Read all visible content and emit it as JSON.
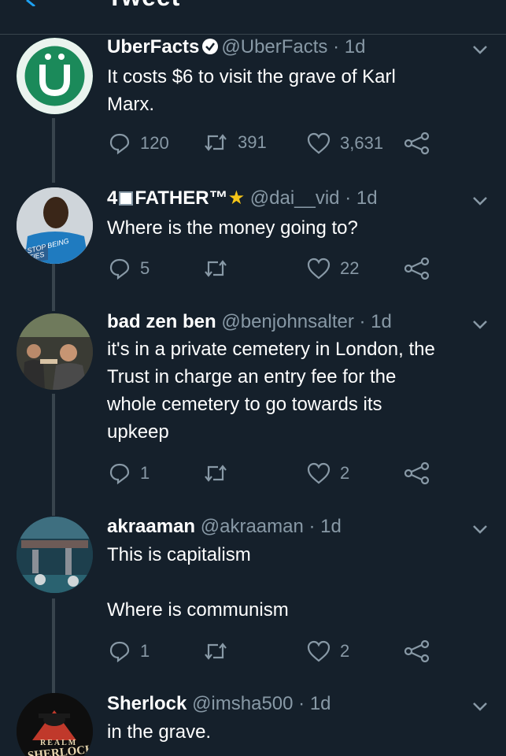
{
  "header": {
    "title": "Tweet"
  },
  "colors": {
    "background": "#15202b",
    "secondary_text": "#8899a6",
    "divider": "#38444d",
    "brand": "#1b8a5a"
  },
  "tweets": [
    {
      "name": "UberFacts",
      "handle": "@UberFacts",
      "time": "· 1d",
      "verified": true,
      "text_lines": [
        "It costs $6 to visit the grave of Karl",
        "Marx."
      ],
      "replies": "120",
      "retweets": "391",
      "likes": "3,631",
      "avatar_icon": "uberfacts-logo-icon"
    },
    {
      "name_prefix": "4",
      "name": "FATHER™",
      "handle": "@dai__vid",
      "time": "· 1d",
      "text_lines": [
        "Where is the money going to?"
      ],
      "replies": "5",
      "retweets": "",
      "likes": "22",
      "avatar_text": "STOP BEING\nTIES"
    },
    {
      "name": "bad zen ben",
      "handle": "@benjohnsalter",
      "time": "· 1d",
      "text_lines": [
        "it's in a private cemetery in London, the",
        "Trust in charge an entry fee for the",
        "whole cemetery to go towards its",
        "upkeep"
      ],
      "replies": "1",
      "retweets": "",
      "likes": "2"
    },
    {
      "name": "akraaman",
      "handle": "@akraaman",
      "time": "· 1d",
      "text_lines": [
        "This is capitalism",
        "",
        "Where is communism"
      ],
      "replies": "1",
      "retweets": "",
      "likes": "2"
    },
    {
      "name": "Sherlock",
      "handle": "@imsha500",
      "time": "· 1d",
      "text_lines": [
        "in the grave."
      ],
      "avatar_text_top": "REALM",
      "avatar_text_bottom": "SHERLOCK"
    }
  ]
}
